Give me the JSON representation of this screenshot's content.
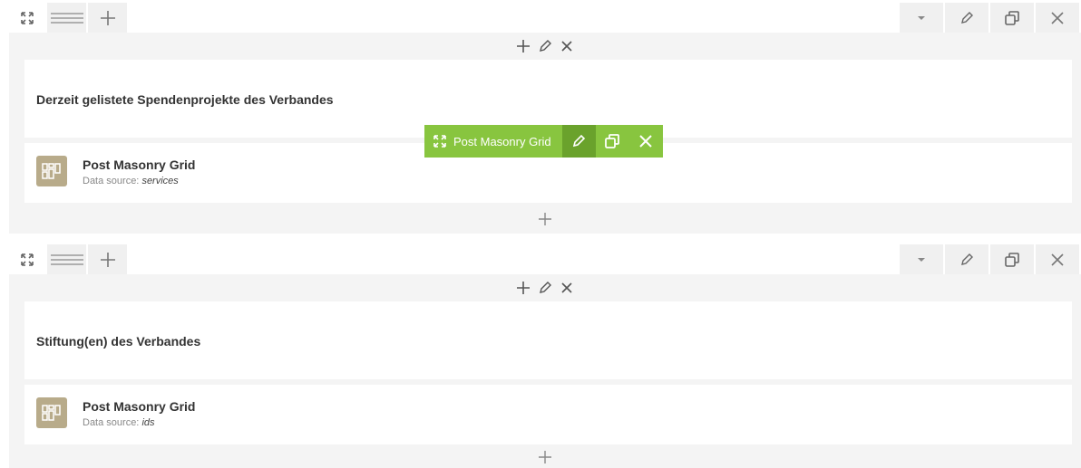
{
  "rows": [
    {
      "text_element": {
        "heading": "Derzeit gelistete Spendenprojekte des Verbandes"
      },
      "grid_element": {
        "title": "Post Masonry Grid",
        "source_label": "Data source:",
        "source_value": "services"
      },
      "hover_toolbar": {
        "label": "Post Masonry Grid"
      }
    },
    {
      "text_element": {
        "heading": "Stiftung(en) des Verbandes"
      },
      "grid_element": {
        "title": "Post Masonry Grid",
        "source_label": "Data source:",
        "source_value": "ids"
      }
    }
  ],
  "colors": {
    "accent_green": "#88c53f",
    "accent_green_dark": "#6aa22c",
    "element_icon_bg": "#b8ab8a",
    "panel_bg": "#f4f4f4"
  },
  "icons": {
    "row_toolbar_left": [
      "expand-icon",
      "drag-handle-icon",
      "add-icon"
    ],
    "row_toolbar_right": [
      "chevron-down-icon",
      "edit-icon",
      "clone-icon",
      "close-icon"
    ],
    "column_controls": [
      "add-icon",
      "edit-icon",
      "close-icon"
    ],
    "element_icon": "grid-icon"
  }
}
